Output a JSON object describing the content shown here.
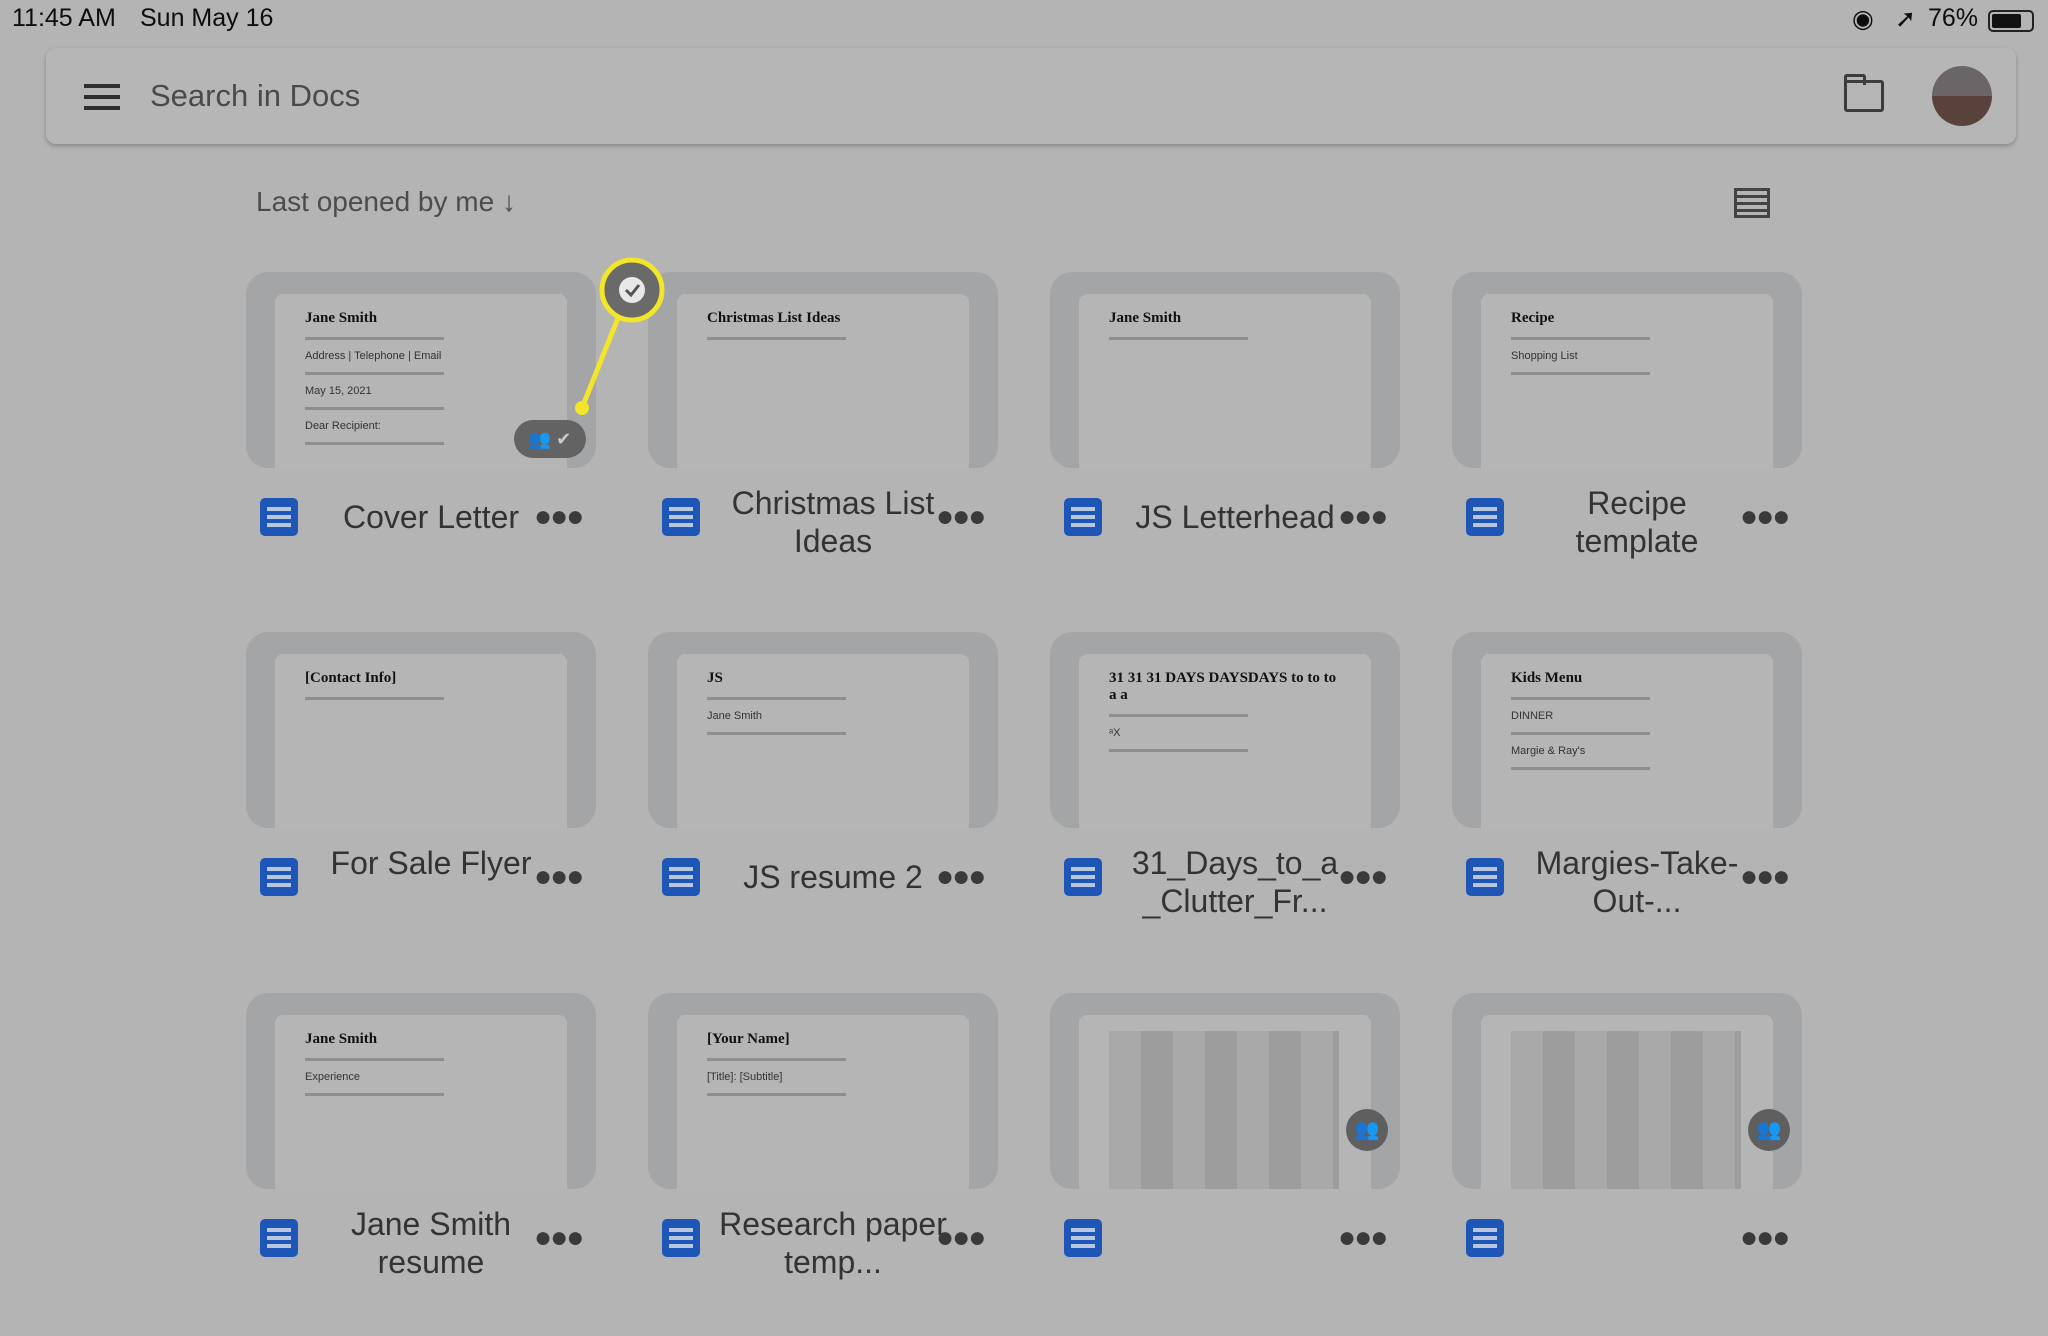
{
  "status_bar": {
    "time": "11:45 AM",
    "date": "Sun May 16",
    "battery": "76%"
  },
  "search": {
    "placeholder": "Search in Docs"
  },
  "sort": {
    "label": "Last opened by me",
    "direction_icon": "arrow-down-icon"
  },
  "accent": "#1d56b6",
  "highlight_color": "#f2e52a",
  "documents": [
    {
      "title": "Cover Letter",
      "preview": [
        "Jane Smith",
        "Address | Telephone | Email",
        "May 15, 2021",
        "Dear Recipient:"
      ],
      "badges": [
        "shared",
        "offline-available"
      ]
    },
    {
      "title": "Christmas List Ideas",
      "preview": [
        "Christmas List Ideas"
      ]
    },
    {
      "title": "JS Letterhead",
      "preview": [
        "Jane Smith"
      ]
    },
    {
      "title": "Recipe template",
      "preview": [
        "Recipe",
        "Shopping List"
      ]
    },
    {
      "title": "For Sale Flyer",
      "preview": [
        "[Contact Info]"
      ]
    },
    {
      "title": "JS resume 2",
      "preview": [
        "JS",
        "Jane Smith"
      ]
    },
    {
      "title": "31_Days_to_a _Clutter_Fr...",
      "preview": [
        "31 31 31 DAYS DAYSDAYS to to to a a",
        "ᵃX"
      ]
    },
    {
      "title": "Margies-Take-Out-...",
      "preview": [
        "Kids Menu",
        "DINNER",
        "Margie & Ray's"
      ]
    },
    {
      "title": "Jane Smith resume",
      "preview": [
        "Jane Smith",
        "Experience"
      ]
    },
    {
      "title": "Research paper temp...",
      "preview": [
        "[Your Name]",
        "[Title]: [Subtitle]"
      ]
    },
    {
      "title": "",
      "preview": [],
      "badges": [
        "shared"
      ]
    },
    {
      "title": "",
      "preview": [],
      "badges": [
        "shared"
      ]
    }
  ]
}
